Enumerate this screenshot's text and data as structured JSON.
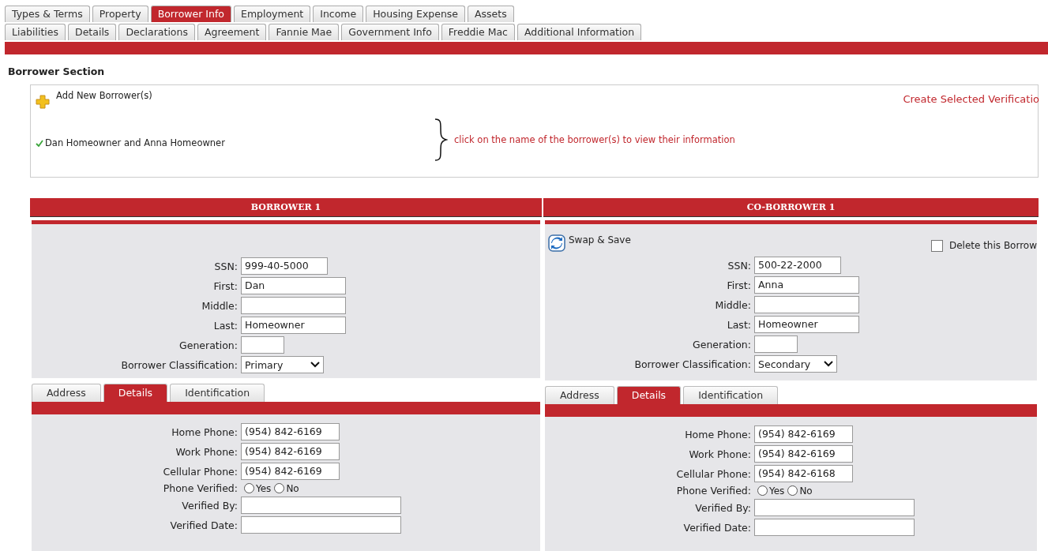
{
  "tabs_row_1": [
    {
      "label": "Types & Terms",
      "selected": false
    },
    {
      "label": "Property",
      "selected": false
    },
    {
      "label": "Borrower Info",
      "selected": true
    },
    {
      "label": "Employment",
      "selected": false
    },
    {
      "label": "Income",
      "selected": false
    },
    {
      "label": "Housing Expense",
      "selected": false
    },
    {
      "label": "Assets",
      "selected": false
    }
  ],
  "tabs_row_2": [
    {
      "label": "Liabilities",
      "selected": false
    },
    {
      "label": "Details",
      "selected": false
    },
    {
      "label": "Declarations",
      "selected": false
    },
    {
      "label": "Agreement",
      "selected": false
    },
    {
      "label": "Fannie Mae",
      "selected": false
    },
    {
      "label": "Government Info",
      "selected": false
    },
    {
      "label": "Freddie Mac",
      "selected": false
    },
    {
      "label": "Additional Information",
      "selected": false
    }
  ],
  "section_title": "Borrower Section",
  "borrower_box": {
    "add_link": "Add New Borrower(s)",
    "verification_link": "Create Selected Verificatio",
    "hint": "click on the name of the borrower(s) to view their information",
    "borrowers": [
      {
        "name": "Dan Homeowner and Anna Homeowner",
        "checked": true
      }
    ]
  },
  "panels": [
    {
      "title": "BORROWER 1",
      "fields": [
        {
          "kind": "ssn",
          "label": "SSN:",
          "value": "999-40-5000"
        },
        {
          "kind": "text",
          "label": "First:",
          "value": "Dan"
        },
        {
          "kind": "text",
          "label": "Middle:"
        },
        {
          "kind": "text",
          "label": "Last:",
          "value": "Homeowner"
        },
        {
          "kind": "short",
          "label": "Generation:"
        },
        {
          "kind": "select",
          "label": "Borrower Classification:",
          "value": "Primary"
        }
      ],
      "sub_tabs": [
        {
          "label": "Address",
          "selected": false
        },
        {
          "label": "Details",
          "selected": true
        },
        {
          "label": "Identification",
          "selected": false
        }
      ],
      "details": [
        {
          "kind": "phone",
          "label": "Home Phone:",
          "value": "(954) 842-6169"
        },
        {
          "kind": "phone",
          "label": "Work Phone:",
          "value": "(954) 842-6169"
        },
        {
          "kind": "phone",
          "label": "Cellular Phone:",
          "value": "(954) 842-6169"
        },
        {
          "kind": "radio",
          "label": "Phone Verified:",
          "options": [
            {
              "label": "Yes",
              "selected": false
            },
            {
              "label": "No",
              "selected": false
            }
          ]
        },
        {
          "kind": "wide",
          "label": "Verified By:"
        },
        {
          "kind": "wide",
          "label": "Verified Date:"
        }
      ]
    },
    {
      "title": "CO-BORROWER 1",
      "swap_button": "Swap & Save",
      "delete": {
        "label": "Delete this Borrow",
        "checked": false
      },
      "fields": [
        {
          "kind": "ssn",
          "label": "SSN:",
          "value": "500-22-2000"
        },
        {
          "kind": "text",
          "label": "First:",
          "value": "Anna"
        },
        {
          "kind": "text",
          "label": "Middle:"
        },
        {
          "kind": "text",
          "label": "Last:",
          "value": "Homeowner"
        },
        {
          "kind": "short",
          "label": "Generation:"
        },
        {
          "kind": "select",
          "label": "Borrower Classification:",
          "value": "Secondary"
        }
      ],
      "sub_tabs": [
        {
          "label": "Address",
          "selected": false
        },
        {
          "label": "Details",
          "selected": true
        },
        {
          "label": "Identification",
          "selected": false
        }
      ],
      "details": [
        {
          "kind": "phone",
          "label": "Home Phone:",
          "value": "(954) 842-6169"
        },
        {
          "kind": "phone",
          "label": "Work Phone:",
          "value": "(954) 842-6169"
        },
        {
          "kind": "phone",
          "label": "Cellular Phone:",
          "value": "(954) 842-6168"
        },
        {
          "kind": "radio",
          "label": "Phone Verified:",
          "options": [
            {
              "label": "Yes",
              "selected": false
            },
            {
              "label": "No",
              "selected": false
            }
          ]
        },
        {
          "kind": "wide",
          "label": "Verified By:"
        },
        {
          "kind": "wide",
          "label": "Verified Date:"
        }
      ]
    }
  ]
}
